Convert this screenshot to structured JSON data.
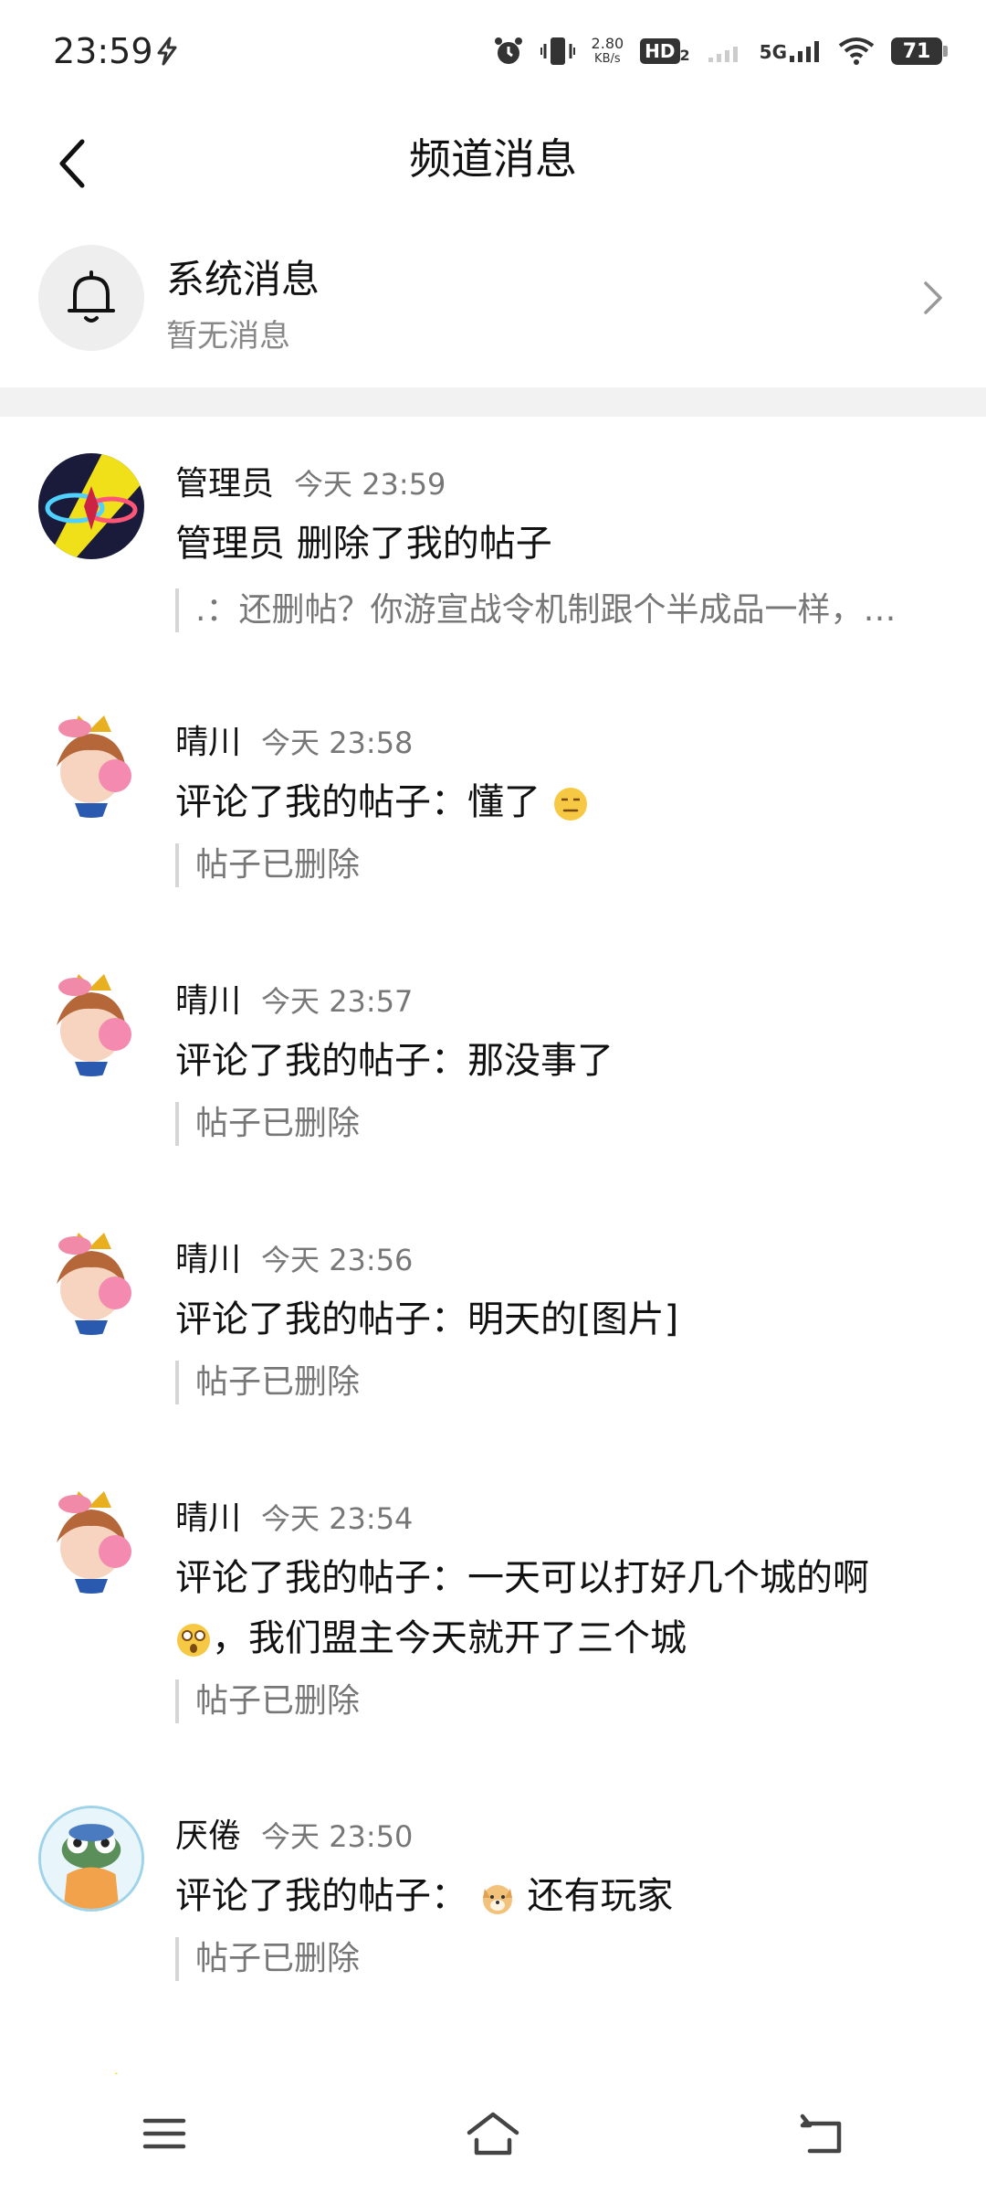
{
  "status_bar": {
    "time": "23:59",
    "net_speed_value": "2.80",
    "net_speed_unit": "KB/s",
    "hd_label": "HD",
    "hd_sub": "2",
    "network_label": "5G",
    "battery": "71"
  },
  "header": {
    "title": "频道消息"
  },
  "system_message": {
    "title": "系统消息",
    "subtitle": "暂无消息"
  },
  "notifications": [
    {
      "user": "管理员",
      "time": "今天 23:59",
      "action": "管理员 删除了我的帖子",
      "quote": ".：还删帖？你游宣战令机制跟个半成品一样，…"
    },
    {
      "user": "晴川",
      "time": "今天 23:58",
      "action": "评论了我的帖子：懂了",
      "quote": "帖子已删除"
    },
    {
      "user": "晴川",
      "time": "今天 23:57",
      "action": "评论了我的帖子：那没事了",
      "quote": "帖子已删除"
    },
    {
      "user": "晴川",
      "time": "今天 23:56",
      "action": "评论了我的帖子：明天的[图片]",
      "quote": "帖子已删除"
    },
    {
      "user": "晴川",
      "time": "今天 23:54",
      "action_a": "评论了我的帖子：一天可以打好几个城的啊",
      "action_b": "，我们盟主今天就开了三个城",
      "quote": "帖子已删除"
    },
    {
      "user": "厌倦",
      "time": "今天 23:50",
      "action_a": "评论了我的帖子：",
      "action_b": "还有玩家",
      "quote": "帖子已删除"
    }
  ],
  "colors": {
    "text_primary": "#111111",
    "text_secondary": "#777777",
    "divider": "#f2f2f2"
  },
  "icons": {
    "back": "chevron-left-icon",
    "bell": "bell-icon",
    "chevron": "chevron-right-icon",
    "nav_menu": "menu-icon",
    "nav_home": "home-icon",
    "nav_back": "return-icon"
  }
}
